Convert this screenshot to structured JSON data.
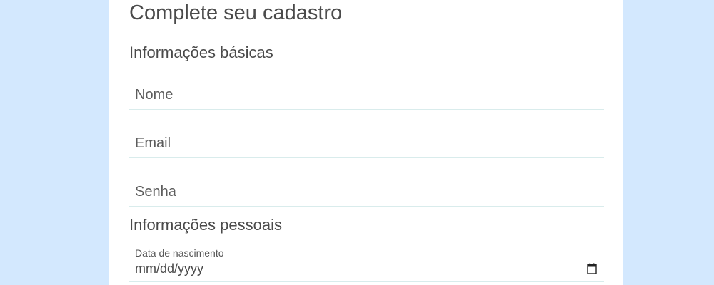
{
  "form": {
    "title": "Complete seu cadastro",
    "basic_section_title": "Informações básicas",
    "name_placeholder": "Nome",
    "email_placeholder": "Email",
    "password_placeholder": "Senha",
    "personal_section_title": "Informações pessoais",
    "birthdate_label": "Data de nascimento",
    "birthdate_placeholder": "mm/dd/yyyy"
  },
  "icons": {
    "calendar": "calendar-icon"
  },
  "colors": {
    "page_background": "#d3e8fe",
    "card_background": "#ffffff",
    "text": "#4a4a4a",
    "input_underline": "#d9ecec"
  }
}
